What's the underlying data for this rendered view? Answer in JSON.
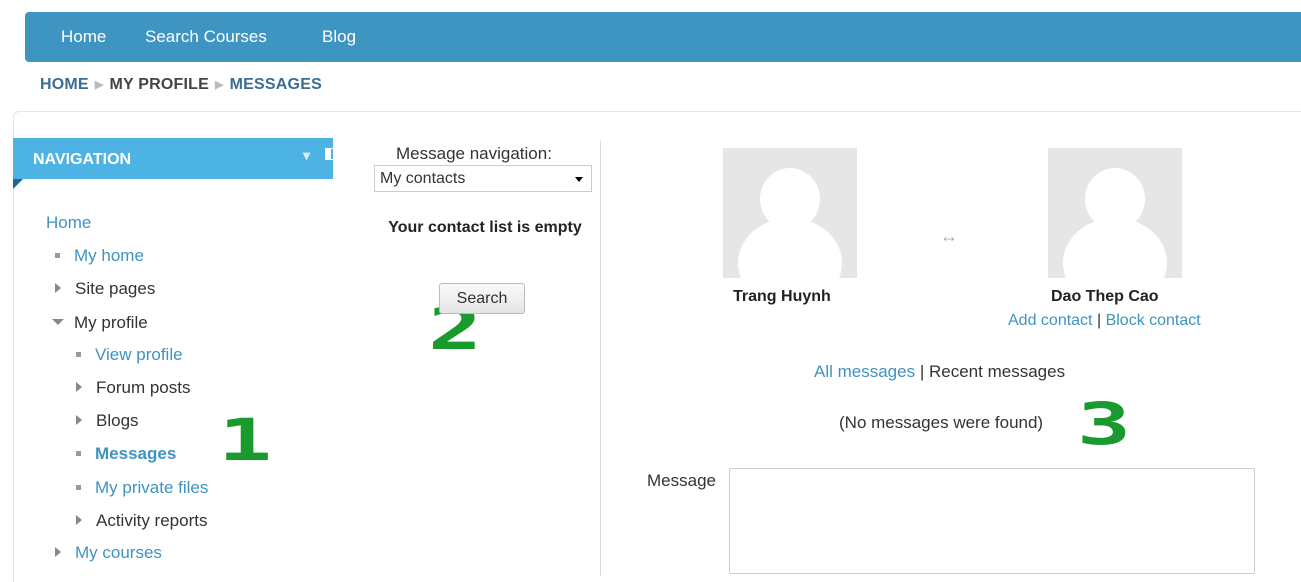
{
  "topnav": {
    "items": [
      "Home",
      "Search Courses",
      "Blog"
    ]
  },
  "breadcrumb": [
    "HOME",
    "MY PROFILE",
    "MESSAGES"
  ],
  "navigation": {
    "title": "NAVIGATION",
    "items": [
      {
        "label": "Home"
      },
      {
        "label": "My home"
      },
      {
        "label": "Site pages"
      },
      {
        "label": "My profile"
      },
      {
        "label": "View profile"
      },
      {
        "label": "Forum posts"
      },
      {
        "label": "Blogs"
      },
      {
        "label": "Messages"
      },
      {
        "label": "My private files"
      },
      {
        "label": "Activity reports"
      },
      {
        "label": "My courses"
      }
    ]
  },
  "message_nav": {
    "label": "Message navigation:",
    "selected": "My contacts",
    "empty_text": "Your contact list is empty",
    "search_label": "Search"
  },
  "conversation": {
    "user1": "Trang Huynh",
    "user2": "Dao Thep Cao",
    "swap_symbol": "↔",
    "add_contact": "Add contact",
    "separator": "|",
    "block_contact": "Block contact",
    "all_messages": "All messages",
    "recent_messages": "Recent messages",
    "no_messages": "(No messages were found)",
    "message_label": "Message"
  },
  "annotations": {
    "marker1": "1",
    "marker2": "2",
    "marker3": "3"
  },
  "colors": {
    "topbar": "#3f95c2",
    "nav_header": "#4db3e4",
    "link": "#3f93c0",
    "marker": "#1a9a2e"
  }
}
